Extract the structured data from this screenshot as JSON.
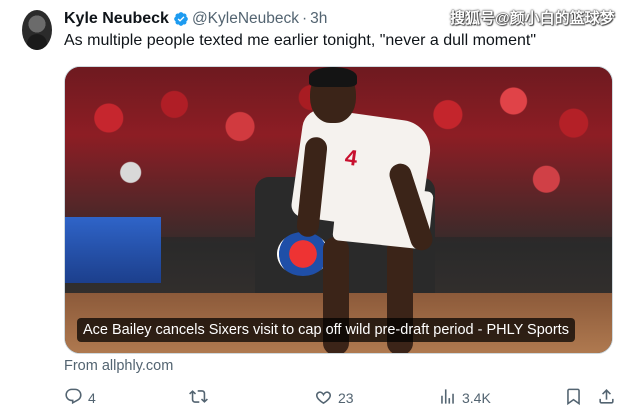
{
  "tweet": {
    "display_name": "Kyle Neubeck",
    "handle": "@KyleNeubeck",
    "separator": "·",
    "time": "3h",
    "text": "As multiple people texted me earlier tonight, \"never a dull moment\"",
    "verified": true
  },
  "watermark": "搜狐号@颜小白的篮球梦",
  "card": {
    "jersey_number": "4",
    "caption": "Ace Bailey cancels Sixers visit to cap off wild pre-draft period - PHLY Sports",
    "source": "From allphly.com"
  },
  "actions": {
    "replies": "4",
    "retweets": "",
    "likes": "23",
    "views": "3.4K"
  },
  "icons": {
    "verified": "verified-badge-icon",
    "reply": "reply-icon",
    "retweet": "retweet-icon",
    "like": "heart-icon",
    "views": "views-icon",
    "bookmark": "bookmark-icon",
    "share": "share-icon"
  },
  "colors": {
    "verified_blue": "#1d9bf0",
    "text_primary": "#0f1419",
    "text_secondary": "#536471"
  }
}
